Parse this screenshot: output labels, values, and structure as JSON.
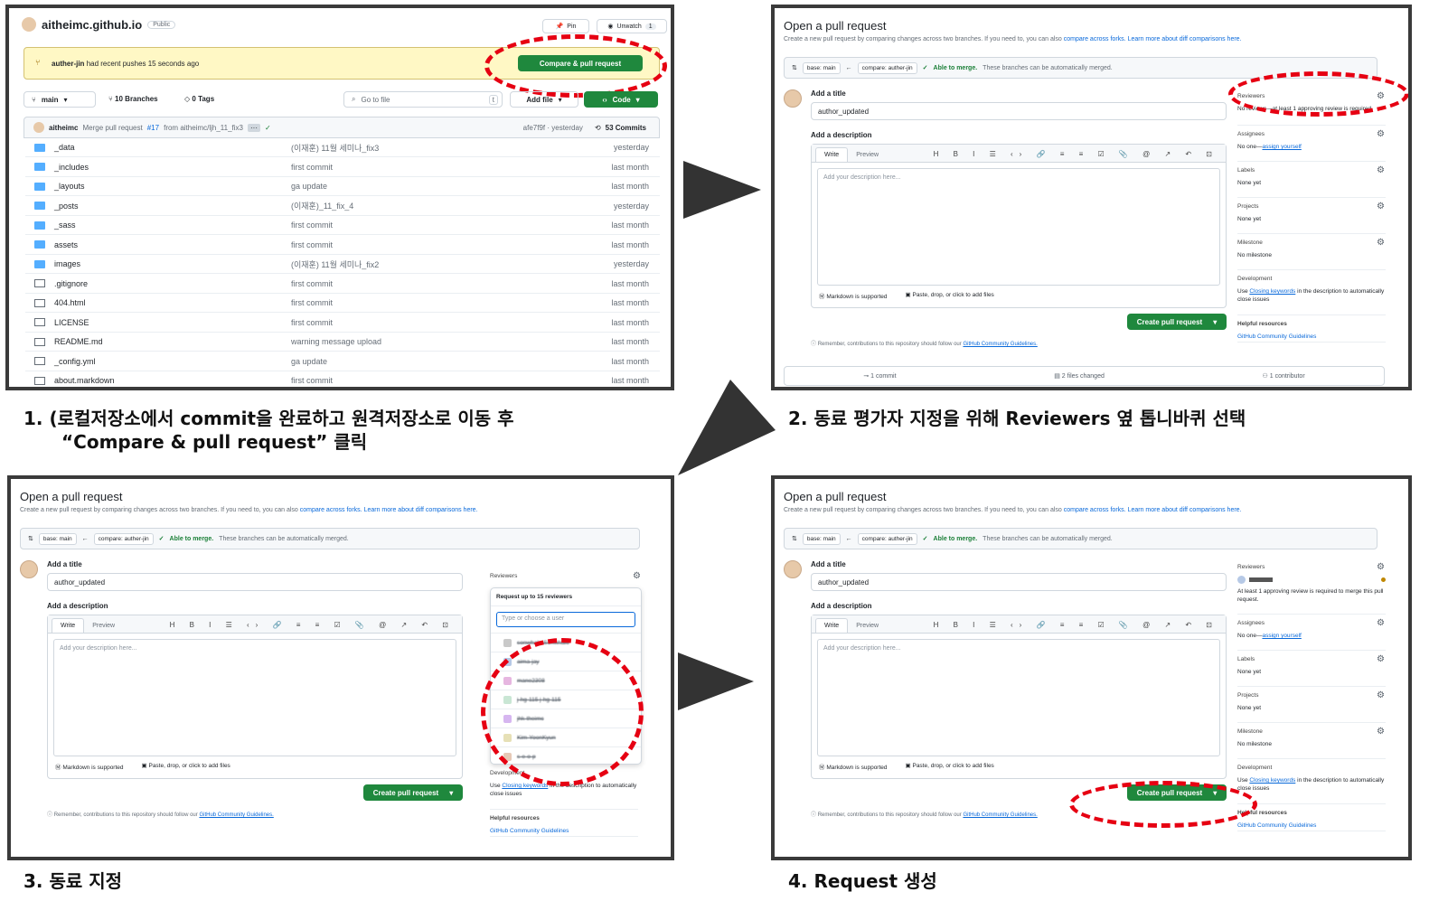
{
  "captions": {
    "step1_line1": "1.  (로컬저장소에서 commit을 완료하고 원격저장소로 이동 후",
    "step1_line2": "“Compare & pull request” 클릭",
    "step2": "2. 동료 평가자 지정을 위해 Reviewers 옆 톱니바퀴 선택",
    "step3": "3. 동료 지정",
    "step4": "4. Request 생성"
  },
  "repo": {
    "name": "aitheimc.github.io",
    "visibility": "Public",
    "pin": "Pin",
    "unwatch": "Unwatch",
    "watch_count": "1",
    "push_branch": "auther-jin",
    "push_text": "had recent pushes 15 seconds ago",
    "compare_button": "Compare & pull request",
    "branch": "main",
    "branches": "10 Branches",
    "tags": "0 Tags",
    "go_to_file": "Go to file",
    "shortcut": "t",
    "add_file": "Add file",
    "code": "Code",
    "commit_user": "aitheimc",
    "commit_msg_a": "Merge pull request",
    "commit_pr": "#17",
    "commit_msg_b": "from aitheimc/ljh_11_fix3",
    "commit_hash": "afe7f9f · yesterday",
    "commits": "53 Commits",
    "files": [
      {
        "name": "_data",
        "type": "folder",
        "msg": "(이재훈) 11월 세미나_fix3",
        "time": "yesterday"
      },
      {
        "name": "_includes",
        "type": "folder",
        "msg": "first commit",
        "time": "last month"
      },
      {
        "name": "_layouts",
        "type": "folder",
        "msg": "ga update",
        "time": "last month"
      },
      {
        "name": "_posts",
        "type": "folder",
        "msg": "(이재훈)_11_fix_4",
        "time": "yesterday"
      },
      {
        "name": "_sass",
        "type": "folder",
        "msg": "first commit",
        "time": "last month"
      },
      {
        "name": "assets",
        "type": "folder",
        "msg": "first commit",
        "time": "last month"
      },
      {
        "name": "images",
        "type": "folder",
        "msg": "(이재훈) 11월 세미나_fix2",
        "time": "yesterday"
      },
      {
        "name": ".gitignore",
        "type": "file",
        "msg": "first commit",
        "time": "last month"
      },
      {
        "name": "404.html",
        "type": "file",
        "msg": "first commit",
        "time": "last month"
      },
      {
        "name": "LICENSE",
        "type": "file",
        "msg": "first commit",
        "time": "last month"
      },
      {
        "name": "README.md",
        "type": "file",
        "msg": "warning message upload",
        "time": "last month"
      },
      {
        "name": "_config.yml",
        "type": "file",
        "msg": "ga update",
        "time": "last month"
      },
      {
        "name": "about.markdown",
        "type": "file",
        "msg": "first commit",
        "time": "last month"
      }
    ]
  },
  "pr": {
    "title": "Open a pull request",
    "subtitle": "Create a new pull request by comparing changes across two branches. If you need to, you can also",
    "compare_forks": "compare across forks.",
    "learn_more": "Learn more about diff comparisons here.",
    "base": "base: main",
    "compare": "compare: auther-jin",
    "able": "Able to merge.",
    "able_rest": "These branches can be automatically merged.",
    "add_title": "Add a title",
    "title_value": "author_updated",
    "add_description": "Add a description",
    "write": "Write",
    "preview": "Preview",
    "toolbar": "H B I ☰ ‹› 🔗 ≡ ≡ ☑ 📎 @ ↗ ↶ ⊡",
    "placeholder": "Add your description here...",
    "markdown": "Markdown is supported",
    "paste": "Paste, drop, or click to add files",
    "create": "Create pull request",
    "remember": "Remember, contributions to this repository should follow our",
    "guidelines": "GitHub Community Guidelines.",
    "reviewers": "Reviewers",
    "reviewers_none": "No reviews—at least 1 approving review is required",
    "review_required": "At least 1 approving review is required to merge this pull request.",
    "assignees": "Assignees",
    "no_one": "No one—",
    "assign_yourself": "assign yourself",
    "labels": "Labels",
    "none_yet": "None yet",
    "projects": "Projects",
    "milestone": "Milestone",
    "no_milestone": "No milestone",
    "development": "Development",
    "use": "Use",
    "closing_keywords": "Closing keywords",
    "dev_rest": "in the description to automatically close issues",
    "helpful": "Helpful resources",
    "guidelines_link": "GitHub Community Guidelines",
    "commits": "1 commit",
    "files_changed": "2 files changed",
    "contributor": "1 contributor",
    "request_up_to": "Request up to 15 reviewers",
    "search_placeholder": "Type or choose a user",
    "users": [
      "sonwhale Sonwhale",
      "aima-jay",
      "mane2308",
      "j-hg-115 j-hg-115",
      "jhk-theimc",
      "Kim-YoonKyun",
      "s-e-o-p"
    ]
  },
  "colors": {
    "accent": "#1f883d",
    "highlight": "#e60012",
    "link": "#0969da"
  }
}
